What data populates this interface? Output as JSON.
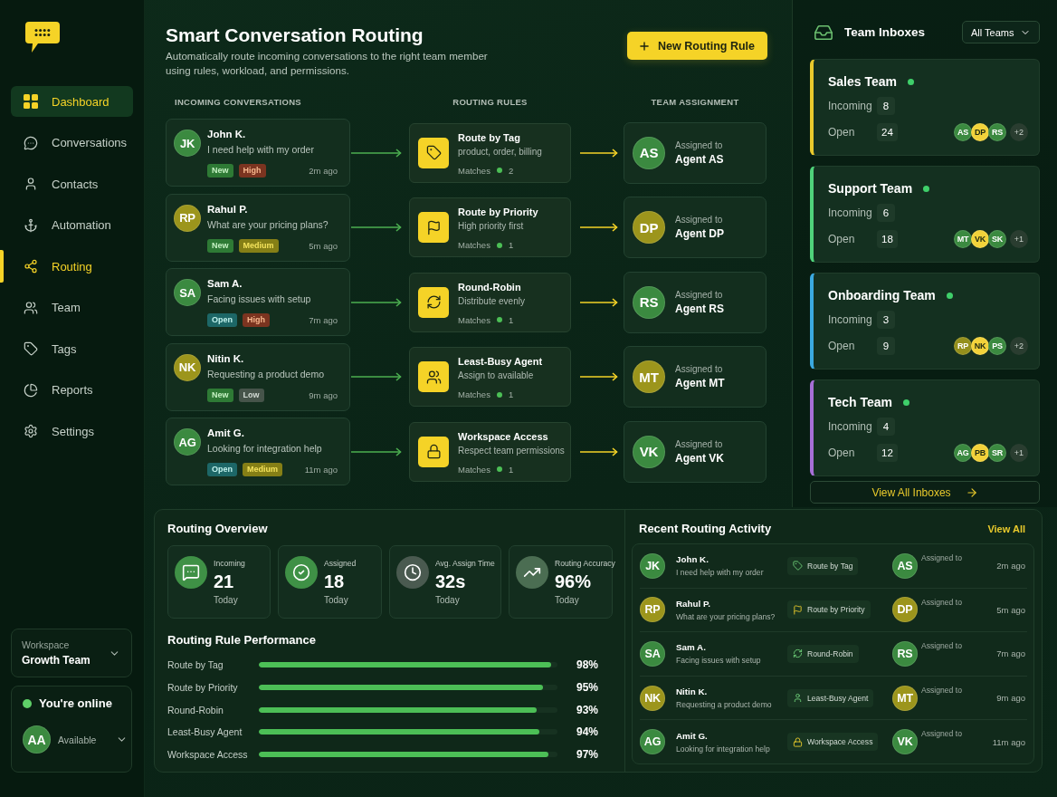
{
  "sidebar": {
    "nav": [
      {
        "label": "Dashboard",
        "selected": false,
        "hovered": true
      },
      {
        "label": "Conversations",
        "selected": false,
        "hovered": false
      },
      {
        "label": "Contacts",
        "selected": false,
        "hovered": false
      },
      {
        "label": "Automation",
        "selected": false,
        "hovered": false
      },
      {
        "label": "Routing",
        "selected": true,
        "hovered": false
      },
      {
        "label": "Team",
        "selected": false,
        "hovered": false
      },
      {
        "label": "Tags",
        "selected": false,
        "hovered": false
      },
      {
        "label": "Reports",
        "selected": false,
        "hovered": false
      },
      {
        "label": "Settings",
        "selected": false,
        "hovered": false
      }
    ],
    "workspace": {
      "label": "Workspace",
      "value": "Growth Team"
    },
    "presence": {
      "online": true,
      "status": "You're online",
      "initials": "AA",
      "color": "#3b8a40",
      "availability": "Available"
    }
  },
  "header": {
    "title": "Smart Conversation Routing",
    "subtitle": "Automatically route incoming conversations to the right team member using rules, workload, and permissions.",
    "button": "New Routing Rule"
  },
  "flow": {
    "columns": [
      "INCOMING CONVERSATIONS",
      "ROUTING RULES",
      "TEAM ASSIGNMENT"
    ],
    "rows": [
      {
        "conversation": {
          "initials": "JK",
          "color": "#3b8a40",
          "name": "John K.",
          "message": "I need help with my order",
          "tags": [
            {
              "label": "New",
              "kind": "new"
            },
            {
              "label": "High",
              "kind": "high"
            }
          ],
          "time": "2m ago"
        },
        "rule": {
          "title": "Route by Tag",
          "description": "product, order, billing",
          "matches_label": "Matches",
          "matches": "2"
        },
        "assignment": {
          "initials": "AS",
          "color": "#3b8a40",
          "label": "Assigned to",
          "agent": "Agent AS"
        }
      },
      {
        "conversation": {
          "initials": "RP",
          "color": "#9c951c",
          "name": "Rahul P.",
          "message": "What are your pricing plans?",
          "tags": [
            {
              "label": "New",
              "kind": "new"
            },
            {
              "label": "Medium",
              "kind": "medium"
            }
          ],
          "time": "5m ago"
        },
        "rule": {
          "title": "Route by Priority",
          "description": "High priority first",
          "matches_label": "Matches",
          "matches": "1"
        },
        "assignment": {
          "initials": "DP",
          "color": "#9c951c",
          "label": "Assigned to",
          "agent": "Agent DP"
        }
      },
      {
        "conversation": {
          "initials": "SA",
          "color": "#3b8a40",
          "name": "Sam A.",
          "message": "Facing issues with setup",
          "tags": [
            {
              "label": "Open",
              "kind": "open"
            },
            {
              "label": "High",
              "kind": "high"
            }
          ],
          "time": "7m ago"
        },
        "rule": {
          "title": "Round-Robin",
          "description": "Distribute evenly",
          "matches_label": "Matches",
          "matches": "1"
        },
        "assignment": {
          "initials": "RS",
          "color": "#3b8a40",
          "label": "Assigned to",
          "agent": "Agent RS"
        }
      },
      {
        "conversation": {
          "initials": "NK",
          "color": "#9c951c",
          "name": "Nitin K.",
          "message": "Requesting a product demo",
          "tags": [
            {
              "label": "New",
              "kind": "new"
            },
            {
              "label": "Low",
              "kind": "low"
            }
          ],
          "time": "9m ago"
        },
        "rule": {
          "title": "Least-Busy Agent",
          "description": "Assign to available",
          "matches_label": "Matches",
          "matches": "1"
        },
        "assignment": {
          "initials": "MT",
          "color": "#9c951c",
          "label": "Assigned to",
          "agent": "Agent MT"
        }
      },
      {
        "conversation": {
          "initials": "AG",
          "color": "#3b8a40",
          "name": "Amit G.",
          "message": "Looking for integration help",
          "tags": [
            {
              "label": "Open",
              "kind": "open"
            },
            {
              "label": "Medium",
              "kind": "medium"
            }
          ],
          "time": "11m ago"
        },
        "rule": {
          "title": "Workspace Access",
          "description": "Respect team permissions",
          "matches_label": "Matches",
          "matches": "1"
        },
        "assignment": {
          "initials": "VK",
          "color": "#3b8a40",
          "label": "Assigned to",
          "agent": "Agent VK"
        }
      }
    ]
  },
  "team_inboxes": {
    "title": "Team Inboxes",
    "filter": "All Teams",
    "teams": [
      {
        "name": "Sales Team",
        "color": "#e9c92c",
        "online": true,
        "incoming_label": "Incoming",
        "incoming": "8",
        "open_label": "Open",
        "open": "24",
        "members": [
          {
            "initials": "AS",
            "color": "#3b8a40"
          },
          {
            "initials": "DP",
            "color": "#f2d23a"
          },
          {
            "initials": "RS",
            "color": "#3b8a40"
          }
        ],
        "more": "+2"
      },
      {
        "name": "Support Team",
        "color": "#4fd27a",
        "online": true,
        "incoming_label": "Incoming",
        "incoming": "6",
        "open_label": "Open",
        "open": "18",
        "members": [
          {
            "initials": "MT",
            "color": "#3b8a40"
          },
          {
            "initials": "VK",
            "color": "#f2d23a"
          },
          {
            "initials": "SK",
            "color": "#3b8a40"
          }
        ],
        "more": "+1"
      },
      {
        "name": "Onboarding Team",
        "color": "#3ba9e0",
        "online": true,
        "incoming_label": "Incoming",
        "incoming": "3",
        "open_label": "Open",
        "open": "9",
        "members": [
          {
            "initials": "RP",
            "color": "#948f1c"
          },
          {
            "initials": "NK",
            "color": "#f2d23a"
          },
          {
            "initials": "PS",
            "color": "#3b8a40"
          }
        ],
        "more": "+2"
      },
      {
        "name": "Tech Team",
        "color": "#a66fd6",
        "online": true,
        "incoming_label": "Incoming",
        "incoming": "4",
        "open_label": "Open",
        "open": "12",
        "members": [
          {
            "initials": "AG",
            "color": "#3b8a40"
          },
          {
            "initials": "PB",
            "color": "#f2d23a"
          },
          {
            "initials": "SR",
            "color": "#3b8a40"
          }
        ],
        "more": "+1"
      }
    ],
    "view_all": "View All Inboxes"
  },
  "routing_overview": {
    "title": "Routing Overview",
    "stats": [
      {
        "label": "Incoming",
        "value": "21",
        "period": "Today",
        "color": "#3f9146"
      },
      {
        "label": "Assigned",
        "value": "18",
        "period": "Today",
        "color": "#3f9146"
      },
      {
        "label": "Avg. Assign Time",
        "value": "32s",
        "period": "Today",
        "color": "#4a5a50"
      },
      {
        "label": "Routing Accuracy",
        "value": "96%",
        "period": "Today",
        "color": "#4b6d52"
      }
    ],
    "performance_title": "Routing Rule Performance",
    "rules": [
      {
        "name": "Route by Tag",
        "level": 0.98,
        "value": "98%"
      },
      {
        "name": "Route by Priority",
        "level": 0.95,
        "value": "95%"
      },
      {
        "name": "Round-Robin",
        "level": 0.93,
        "value": "93%"
      },
      {
        "name": "Least-Busy Agent",
        "level": 0.94,
        "value": "94%"
      },
      {
        "name": "Workspace Access",
        "level": 0.97,
        "value": "97%"
      }
    ]
  },
  "recent_activity": {
    "title": "Recent Routing Activity",
    "view_all": "View All",
    "items": [
      {
        "initials": "JK",
        "color": "#3b8a40",
        "name": "John K.",
        "message": "I need help with my order",
        "rule": "Route by Tag",
        "agent": {
          "initials": "AS",
          "color": "#3b8a40"
        },
        "assigned_label": "Assigned to",
        "time": "2m ago"
      },
      {
        "initials": "RP",
        "color": "#9c951c",
        "name": "Rahul P.",
        "message": "What are your pricing plans?",
        "rule": "Route by Priority",
        "agent": {
          "initials": "DP",
          "color": "#9c951c"
        },
        "assigned_label": "Assigned to",
        "time": "5m ago"
      },
      {
        "initials": "SA",
        "color": "#3b8a40",
        "name": "Sam A.",
        "message": "Facing issues with setup",
        "rule": "Round-Robin",
        "agent": {
          "initials": "RS",
          "color": "#3b8a40"
        },
        "assigned_label": "Assigned to",
        "time": "7m ago"
      },
      {
        "initials": "NK",
        "color": "#9c951c",
        "name": "Nitin K.",
        "message": "Requesting a product demo",
        "rule": "Least-Busy Agent",
        "agent": {
          "initials": "MT",
          "color": "#9c951c"
        },
        "assigned_label": "Assigned to",
        "time": "9m ago"
      },
      {
        "initials": "AG",
        "color": "#3b8a40",
        "name": "Amit G.",
        "message": "Looking for integration help",
        "rule": "Workspace Access",
        "agent": {
          "initials": "VK",
          "color": "#3b8a40"
        },
        "assigned_label": "Assigned to",
        "time": "11m ago"
      }
    ]
  }
}
